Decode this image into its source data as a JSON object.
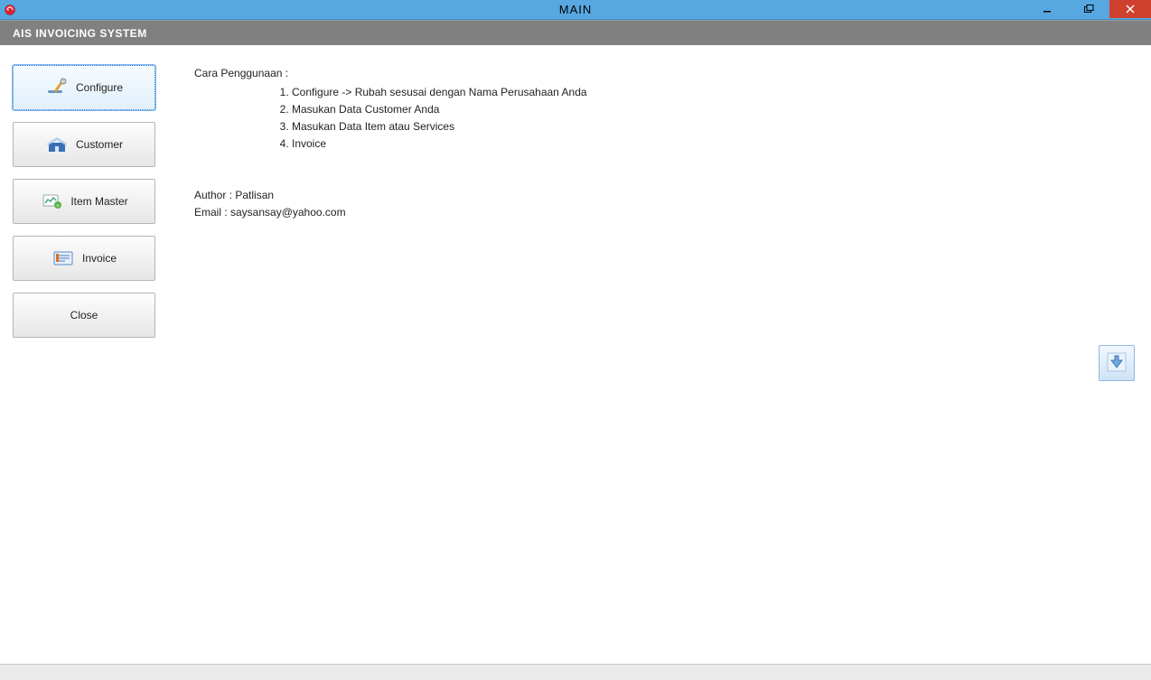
{
  "window": {
    "title": "MAIN"
  },
  "menubar": {
    "title": "AIS INVOICING SYSTEM"
  },
  "sidebar": {
    "items": [
      {
        "label": "Configure",
        "active": true,
        "icon": "configure-icon"
      },
      {
        "label": "Customer",
        "active": false,
        "icon": "customer-icon"
      },
      {
        "label": "Item Master",
        "active": false,
        "icon": "item-master-icon"
      },
      {
        "label": "Invoice",
        "active": false,
        "icon": "invoice-icon"
      },
      {
        "label": "Close",
        "active": false,
        "icon": ""
      }
    ]
  },
  "content": {
    "heading": "Cara Penggunaan :",
    "steps": [
      "Configure -> Rubah sesusai dengan Nama Perusahaan Anda",
      "Masukan Data Customer Anda",
      "Masukan Data Item atau Services",
      "Invoice"
    ],
    "author_label": "Author : Patlisan",
    "email_label": "Email : saysansay@yahoo.com"
  }
}
